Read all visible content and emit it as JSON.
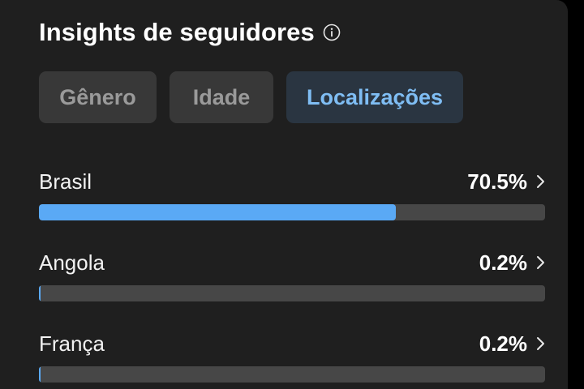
{
  "header": {
    "title": "Insights de seguidores",
    "info_icon": "info-circle-icon"
  },
  "tabs": [
    {
      "label": "Gênero",
      "active": false
    },
    {
      "label": "Idade",
      "active": false
    },
    {
      "label": "Localizações",
      "active": true
    }
  ],
  "locations": [
    {
      "country": "Brasil",
      "percent_label": "70.5%",
      "value": 70.5
    },
    {
      "country": "Angola",
      "percent_label": "0.2%",
      "value": 0.2
    },
    {
      "country": "França",
      "percent_label": "0.2%",
      "value": 0.2
    }
  ],
  "colors": {
    "accent": "#5aa9f5",
    "track": "#474747",
    "background": "#1f1f1f"
  },
  "icons": {
    "row_chevron": "chevron-right-icon"
  }
}
